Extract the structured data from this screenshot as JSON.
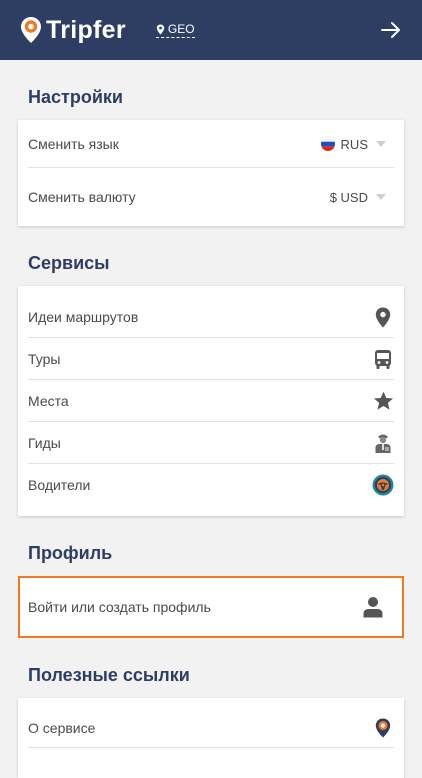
{
  "header": {
    "logo_text": "Tripfer",
    "geo_label": "GEO"
  },
  "settings": {
    "title": "Настройки",
    "items": [
      {
        "label": "Сменить язык",
        "value": "RUS"
      },
      {
        "label": "Сменить валюту",
        "value": "$ USD"
      }
    ]
  },
  "services": {
    "title": "Сервисы",
    "items": [
      {
        "label": "Идеи маршрутов",
        "icon": "map-pin-icon"
      },
      {
        "label": "Туры",
        "icon": "bus-icon"
      },
      {
        "label": "Места",
        "icon": "star-icon"
      },
      {
        "label": "Гиды",
        "icon": "guide-icon"
      },
      {
        "label": "Водители",
        "icon": "steering-wheel-icon"
      }
    ]
  },
  "profile": {
    "title": "Профиль",
    "login_label": "Войти или создать профиль",
    "icon": "user-icon",
    "accent_color": "#f07a22"
  },
  "links": {
    "title": "Полезные ссылки",
    "items": [
      {
        "label": "О сервисе",
        "icon": "tripfer-pin-icon"
      }
    ]
  },
  "colors": {
    "header_bg": "#2e3e63",
    "brand_orange": "#f07a22",
    "page_bg": "#f2f2f2"
  }
}
